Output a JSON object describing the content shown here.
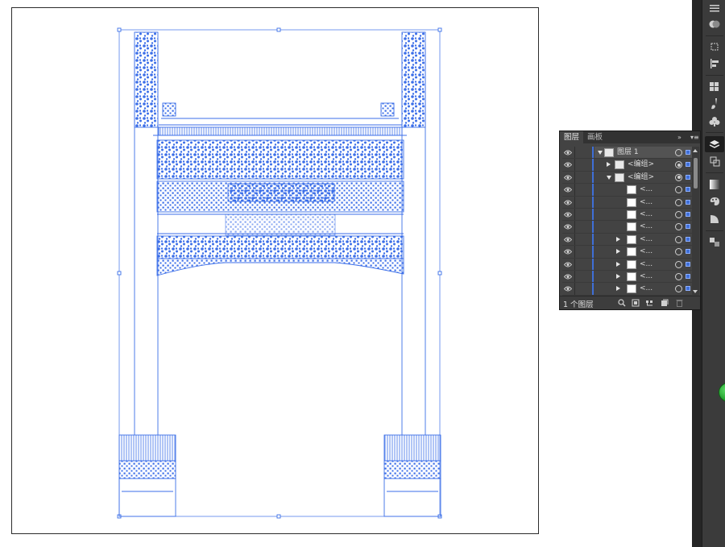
{
  "canvas": {
    "accent": "#3f6fd8",
    "artwork_color": "#3b6ee8"
  },
  "layers_panel": {
    "tabs": [
      {
        "label": "图层",
        "active": true
      },
      {
        "label": "画板",
        "active": false
      }
    ],
    "collapse_icon": "double-chevron-right-icon",
    "menu_icon": "panel-menu-icon",
    "rows": [
      {
        "name": "图层 1",
        "expanded": true,
        "has_children": true,
        "indent": 0,
        "selected": true,
        "target_filled": false
      },
      {
        "name": "<编组>",
        "expanded": false,
        "has_children": true,
        "indent": 1,
        "selected": false,
        "target_filled": true
      },
      {
        "name": "<编组>",
        "expanded": true,
        "has_children": true,
        "indent": 1,
        "selected": false,
        "target_filled": true
      },
      {
        "name": "<...",
        "expanded": false,
        "has_children": false,
        "indent": 2,
        "selected": false,
        "target_filled": false
      },
      {
        "name": "<...",
        "expanded": false,
        "has_children": false,
        "indent": 2,
        "selected": false,
        "target_filled": false
      },
      {
        "name": "<...",
        "expanded": false,
        "has_children": false,
        "indent": 2,
        "selected": false,
        "target_filled": false
      },
      {
        "name": "<...",
        "expanded": false,
        "has_children": false,
        "indent": 2,
        "selected": false,
        "target_filled": false
      },
      {
        "name": "<...",
        "expanded": false,
        "has_children": true,
        "indent": 2,
        "selected": false,
        "target_filled": false
      },
      {
        "name": "<...",
        "expanded": false,
        "has_children": true,
        "indent": 2,
        "selected": false,
        "target_filled": false
      },
      {
        "name": "<...",
        "expanded": false,
        "has_children": true,
        "indent": 2,
        "selected": false,
        "target_filled": false
      },
      {
        "name": "<...",
        "expanded": false,
        "has_children": true,
        "indent": 2,
        "selected": false,
        "target_filled": false
      },
      {
        "name": "<...",
        "expanded": false,
        "has_children": true,
        "indent": 2,
        "selected": false,
        "target_filled": false
      }
    ],
    "footer": {
      "layer_count": "1 个图层",
      "buttons": [
        "locate-object-icon",
        "make-clipping-mask-icon",
        "create-sublayer-icon",
        "create-layer-icon",
        "delete-icon"
      ]
    }
  },
  "toolbar": {
    "tools": [
      "panel-menu-icon",
      "appearance-icon",
      "transform-icon",
      "align-icon",
      "swatches-icon",
      "brushes-icon",
      "symbols-icon",
      "layers-icon",
      "pathfinder-icon",
      "gradient-icon",
      "color-guide-icon",
      "transparency-icon",
      "artboards-icon"
    ]
  }
}
